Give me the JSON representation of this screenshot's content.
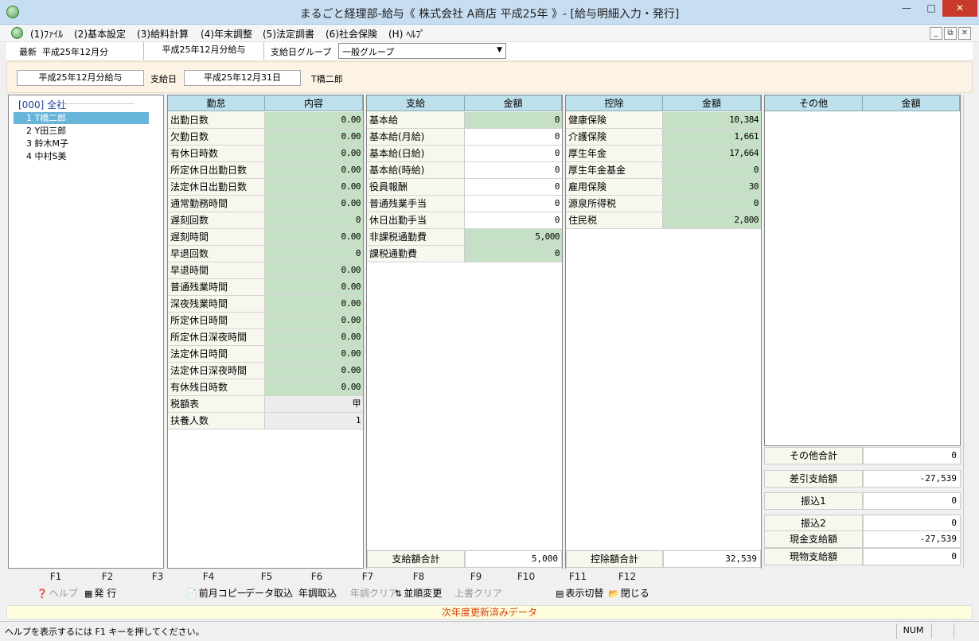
{
  "window": {
    "title": "まるごと経理部-給与《 株式会社 A商店 平成25年 》- [給与明細入力・発行]"
  },
  "menu": [
    "(1)ﾌｧｲﾙ",
    "(2)基本設定",
    "(3)給料計算",
    "(4)年末調整",
    "(5)法定調書",
    "(6)社会保険",
    "(H) ﾍﾙﾌﾟ"
  ],
  "infobar": {
    "latest_label": "最新",
    "latest_value": "平成25年12月分",
    "period": "平成25年12月分給与",
    "group_label": "支給日グループ",
    "group_value": "一般グループ"
  },
  "header": {
    "period": "平成25年12月分給与",
    "payday_label": "支給日",
    "payday": "平成25年12月31日",
    "employee": "T橋二郎"
  },
  "tree": {
    "root": "[000] 全社",
    "items": [
      "1 T橋二郎",
      "2 Y田三郎",
      "3 鈴木M子",
      "4 中村S美"
    ]
  },
  "attendance": {
    "h1": "勤怠",
    "h2": "内容",
    "rows": [
      {
        "label": "出勤日数",
        "value": "0.00"
      },
      {
        "label": "欠勤日数",
        "value": "0.00"
      },
      {
        "label": "有休日時数",
        "value": "0.00"
      },
      {
        "label": "所定休日出勤日数",
        "value": "0.00"
      },
      {
        "label": "法定休日出勤日数",
        "value": "0.00"
      },
      {
        "label": "通常勤務時間",
        "value": "0.00"
      },
      {
        "label": "遅刻回数",
        "value": "0"
      },
      {
        "label": "遅刻時間",
        "value": "0.00"
      },
      {
        "label": "早退回数",
        "value": "0"
      },
      {
        "label": "早退時間",
        "value": "0.00"
      },
      {
        "label": "普通残業時間",
        "value": "0.00"
      },
      {
        "label": "深夜残業時間",
        "value": "0.00"
      },
      {
        "label": "所定休日時間",
        "value": "0.00"
      },
      {
        "label": "所定休日深夜時間",
        "value": "0.00"
      },
      {
        "label": "法定休日時間",
        "value": "0.00"
      },
      {
        "label": "法定休日深夜時間",
        "value": "0.00"
      },
      {
        "label": "有休残日時数",
        "value": "0.00"
      },
      {
        "label": "税額表",
        "value": "甲"
      },
      {
        "label": "扶養人数",
        "value": "1"
      }
    ]
  },
  "payment": {
    "h1": "支給",
    "h2": "金額",
    "rows": [
      {
        "label": "基本給",
        "value": "0"
      },
      {
        "label": "基本給(月給)",
        "value": "0"
      },
      {
        "label": "基本給(日給)",
        "value": "0"
      },
      {
        "label": "基本給(時給)",
        "value": "0"
      },
      {
        "label": "役員報酬",
        "value": "0"
      },
      {
        "label": "普通残業手当",
        "value": "0"
      },
      {
        "label": "休日出勤手当",
        "value": "0"
      },
      {
        "label": "非課税通勤費",
        "value": "5,000"
      },
      {
        "label": "課税通勤費",
        "value": "0"
      }
    ],
    "total_label": "支給額合計",
    "total": "5,000"
  },
  "deduction": {
    "h1": "控除",
    "h2": "金額",
    "rows": [
      {
        "label": "健康保険",
        "value": "10,384"
      },
      {
        "label": "介護保険",
        "value": "1,661"
      },
      {
        "label": "厚生年金",
        "value": "17,664"
      },
      {
        "label": "厚生年金基金",
        "value": "0"
      },
      {
        "label": "雇用保険",
        "value": "30"
      },
      {
        "label": "源泉所得税",
        "value": "0"
      },
      {
        "label": "住民税",
        "value": "2,800"
      }
    ],
    "total_label": "控除額合計",
    "total": "32,539"
  },
  "other": {
    "h1": "その他",
    "h2": "金額",
    "summary": [
      {
        "label": "その他合計",
        "value": "0"
      },
      {
        "label": "差引支給額",
        "value": "-27,539"
      },
      {
        "label": "振込1",
        "value": "0"
      },
      {
        "label": "振込2",
        "value": "0"
      },
      {
        "label": "現金支給額",
        "value": "-27,539"
      },
      {
        "label": "現物支給額",
        "value": "0"
      }
    ]
  },
  "fkeys": [
    "F1",
    "F2",
    "F3",
    "F4",
    "F5",
    "F6",
    "F7",
    "F8",
    "F9",
    "F10",
    "F11",
    "F12"
  ],
  "factions": {
    "help": "ヘルプ",
    "issue": "発 行",
    "prev_copy": "前月コピー",
    "data_import": "データ取込",
    "year_import": "年調取込",
    "year_clear": "年調クリア",
    "reorder": "並順変更",
    "overwrite_clear": "上書クリア",
    "toggle_display": "表示切替",
    "close": "閉じる"
  },
  "notice": "次年度更新済みデータ",
  "status": {
    "help_text": "ヘルプを表示するには F1 キーを押してください。",
    "num": "NUM"
  }
}
